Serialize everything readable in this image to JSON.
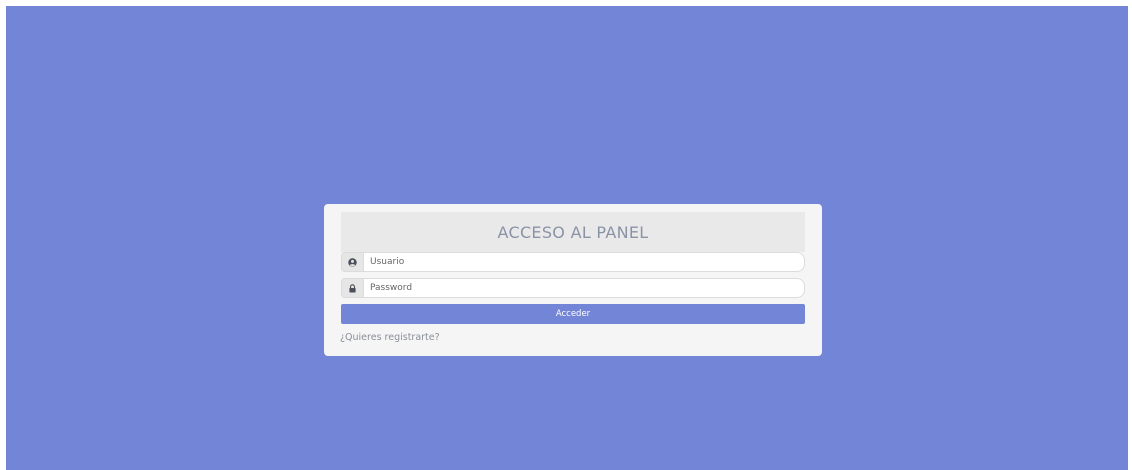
{
  "colors": {
    "background": "#7385d6",
    "card": "#f5f5f5",
    "header": "#e9e9e9",
    "button": "#7385d6"
  },
  "panel": {
    "title": "ACCESO AL PANEL"
  },
  "form": {
    "username": {
      "icon": "user-circle-icon",
      "placeholder": "Usuario",
      "value": ""
    },
    "password": {
      "icon": "lock-icon",
      "placeholder": "Password",
      "value": ""
    },
    "submit_label": "Acceder"
  },
  "register_link": "¿Quieres registrarte?"
}
